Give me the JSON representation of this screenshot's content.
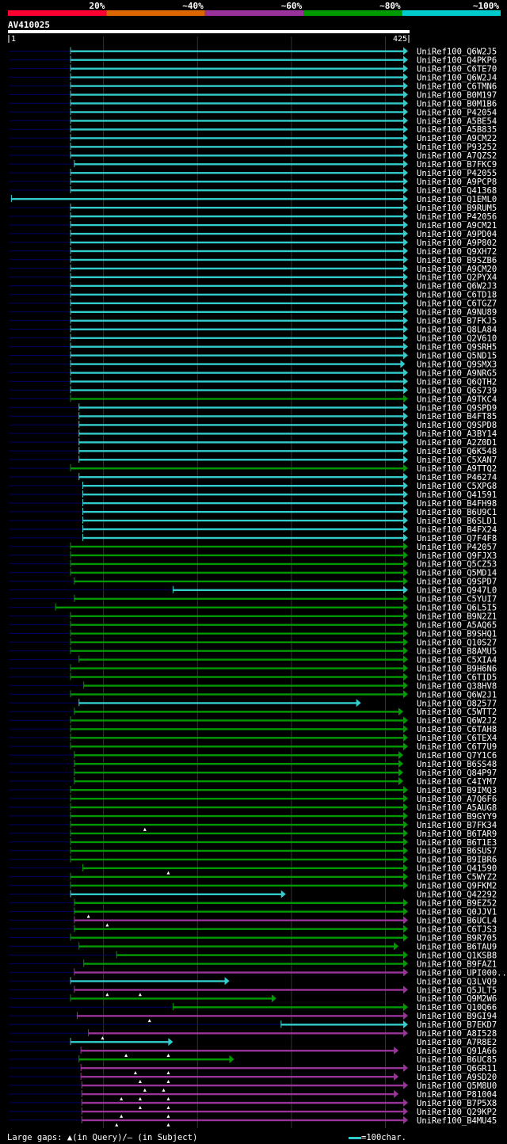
{
  "chart_data": {
    "type": "alignment-overview",
    "query_id": "AV410025",
    "query_start": "1",
    "query_end": "425",
    "query_length": 425,
    "identity_legend": [
      {
        "label": "20%",
        "color": "#ff0033"
      },
      {
        "label": "~40%",
        "color": "#dd6600"
      },
      {
        "label": "~60%",
        "color": "#993399"
      },
      {
        "label": "~80%",
        "color": "#009900"
      },
      {
        "label": "~100%",
        "color": "#00cccc"
      }
    ],
    "hits": [
      {
        "name": "UniRef100_Q6W2J5",
        "start": 66,
        "end": 425,
        "color": "cyan",
        "arrow": true
      },
      {
        "name": "UniRef100_Q4PKP6",
        "start": 66,
        "end": 425,
        "color": "cyan",
        "arrow": true
      },
      {
        "name": "UniRef100_C6TE70",
        "start": 66,
        "end": 425,
        "color": "cyan",
        "arrow": true
      },
      {
        "name": "UniRef100_Q6W2J4",
        "start": 66,
        "end": 425,
        "color": "cyan",
        "arrow": true
      },
      {
        "name": "UniRef100_C6TMN6",
        "start": 66,
        "end": 425,
        "color": "cyan",
        "arrow": true
      },
      {
        "name": "UniRef100_B0M197",
        "start": 66,
        "end": 425,
        "color": "cyan",
        "arrow": true
      },
      {
        "name": "UniRef100_B0M1B6",
        "start": 66,
        "end": 425,
        "color": "cyan",
        "arrow": true
      },
      {
        "name": "UniRef100_P42054",
        "start": 66,
        "end": 425,
        "color": "cyan",
        "arrow": true
      },
      {
        "name": "UniRef100_A5BE54",
        "start": 66,
        "end": 425,
        "color": "cyan",
        "arrow": true
      },
      {
        "name": "UniRef100_A5B835",
        "start": 66,
        "end": 425,
        "color": "cyan",
        "arrow": true
      },
      {
        "name": "UniRef100_A9CM22",
        "start": 66,
        "end": 425,
        "color": "cyan",
        "arrow": true
      },
      {
        "name": "UniRef100_P93252",
        "start": 66,
        "end": 425,
        "color": "cyan",
        "arrow": true
      },
      {
        "name": "UniRef100_A7QZS2",
        "start": 66,
        "end": 425,
        "color": "cyan",
        "arrow": true
      },
      {
        "name": "UniRef100_B7FKC9",
        "start": 70,
        "end": 425,
        "color": "cyan",
        "arrow": true
      },
      {
        "name": "UniRef100_P42055",
        "start": 66,
        "end": 425,
        "color": "cyan",
        "arrow": true
      },
      {
        "name": "UniRef100_A9PCP8",
        "start": 66,
        "end": 425,
        "color": "cyan",
        "arrow": true
      },
      {
        "name": "UniRef100_Q41368",
        "start": 66,
        "end": 425,
        "color": "cyan",
        "arrow": true
      },
      {
        "name": "UniRef100_Q1EML0",
        "start": 3,
        "end": 425,
        "color": "cyan",
        "arrow": true
      },
      {
        "name": "UniRef100_B9RUM5",
        "start": 66,
        "end": 425,
        "color": "cyan",
        "arrow": true
      },
      {
        "name": "UniRef100_P42056",
        "start": 66,
        "end": 425,
        "color": "cyan",
        "arrow": true
      },
      {
        "name": "UniRef100_A9CM21",
        "start": 66,
        "end": 425,
        "color": "cyan",
        "arrow": true
      },
      {
        "name": "UniRef100_A9PD04",
        "start": 66,
        "end": 425,
        "color": "cyan",
        "arrow": true
      },
      {
        "name": "UniRef100_A9P802",
        "start": 66,
        "end": 425,
        "color": "cyan",
        "arrow": true
      },
      {
        "name": "UniRef100_Q9XH72",
        "start": 66,
        "end": 425,
        "color": "cyan",
        "arrow": true
      },
      {
        "name": "UniRef100_B9SZB6",
        "start": 66,
        "end": 425,
        "color": "cyan",
        "arrow": true
      },
      {
        "name": "UniRef100_A9CM20",
        "start": 66,
        "end": 425,
        "color": "cyan",
        "arrow": true
      },
      {
        "name": "UniRef100_Q2PYX4",
        "start": 66,
        "end": 425,
        "color": "cyan",
        "arrow": true
      },
      {
        "name": "UniRef100_Q6W2J3",
        "start": 66,
        "end": 425,
        "color": "cyan",
        "arrow": true
      },
      {
        "name": "UniRef100_C6TD18",
        "start": 66,
        "end": 425,
        "color": "cyan",
        "arrow": true
      },
      {
        "name": "UniRef100_C6TGZ7",
        "start": 66,
        "end": 425,
        "color": "cyan",
        "arrow": true
      },
      {
        "name": "UniRef100_A9NU89",
        "start": 66,
        "end": 425,
        "color": "cyan",
        "arrow": true
      },
      {
        "name": "UniRef100_B7FKJ5",
        "start": 66,
        "end": 425,
        "color": "cyan",
        "arrow": true
      },
      {
        "name": "UniRef100_Q8LA84",
        "start": 66,
        "end": 425,
        "color": "cyan",
        "arrow": true
      },
      {
        "name": "UniRef100_Q2V610",
        "start": 66,
        "end": 425,
        "color": "cyan",
        "arrow": true
      },
      {
        "name": "UniRef100_Q9SRH5",
        "start": 66,
        "end": 425,
        "color": "cyan",
        "arrow": true
      },
      {
        "name": "UniRef100_Q5ND15",
        "start": 66,
        "end": 425,
        "color": "cyan",
        "arrow": true
      },
      {
        "name": "UniRef100_Q9SMX3",
        "start": 66,
        "end": 422,
        "color": "cyan",
        "arrow": true
      },
      {
        "name": "UniRef100_A9NRG5",
        "start": 66,
        "end": 425,
        "color": "cyan",
        "arrow": true
      },
      {
        "name": "UniRef100_Q6QTH2",
        "start": 66,
        "end": 425,
        "color": "cyan",
        "arrow": true
      },
      {
        "name": "UniRef100_Q6S739",
        "start": 66,
        "end": 425,
        "color": "cyan",
        "arrow": true
      },
      {
        "name": "UniRef100_A9TKC4",
        "start": 66,
        "end": 425,
        "color": "green",
        "arrow": true
      },
      {
        "name": "UniRef100_Q9SPD9",
        "start": 75,
        "end": 425,
        "color": "cyan",
        "arrow": true
      },
      {
        "name": "UniRef100_B4FT85",
        "start": 75,
        "end": 425,
        "color": "cyan",
        "arrow": true
      },
      {
        "name": "UniRef100_Q9SPD8",
        "start": 75,
        "end": 425,
        "color": "cyan",
        "arrow": true
      },
      {
        "name": "UniRef100_A3BY14",
        "start": 75,
        "end": 425,
        "color": "cyan",
        "arrow": true
      },
      {
        "name": "UniRef100_A2Z0D1",
        "start": 75,
        "end": 425,
        "color": "cyan",
        "arrow": true
      },
      {
        "name": "UniRef100_Q6K548",
        "start": 75,
        "end": 425,
        "color": "cyan",
        "arrow": true
      },
      {
        "name": "UniRef100_C5XAN7",
        "start": 75,
        "end": 425,
        "color": "cyan",
        "arrow": true
      },
      {
        "name": "UniRef100_A9TTQ2",
        "start": 66,
        "end": 425,
        "color": "green",
        "arrow": true
      },
      {
        "name": "UniRef100_P46274",
        "start": 75,
        "end": 425,
        "color": "cyan",
        "arrow": true
      },
      {
        "name": "UniRef100_C5XPG8",
        "start": 79,
        "end": 425,
        "color": "cyan",
        "arrow": true
      },
      {
        "name": "UniRef100_Q41591",
        "start": 79,
        "end": 425,
        "color": "cyan",
        "arrow": true
      },
      {
        "name": "UniRef100_B4FH98",
        "start": 79,
        "end": 425,
        "color": "cyan",
        "arrow": true
      },
      {
        "name": "UniRef100_B6U9C1",
        "start": 79,
        "end": 425,
        "color": "cyan",
        "arrow": true
      },
      {
        "name": "UniRef100_B6SLD1",
        "start": 79,
        "end": 425,
        "color": "cyan",
        "arrow": true
      },
      {
        "name": "UniRef100_B4FX24",
        "start": 79,
        "end": 425,
        "color": "cyan",
        "arrow": true
      },
      {
        "name": "UniRef100_Q7F4F8",
        "start": 79,
        "end": 425,
        "color": "cyan",
        "arrow": true
      },
      {
        "name": "UniRef100_P42057",
        "start": 66,
        "end": 425,
        "color": "green",
        "arrow": true
      },
      {
        "name": "UniRef100_Q9FJX3",
        "start": 66,
        "end": 425,
        "color": "green",
        "arrow": true
      },
      {
        "name": "UniRef100_Q5CZ53",
        "start": 66,
        "end": 425,
        "color": "green",
        "arrow": true
      },
      {
        "name": "UniRef100_Q5MD14",
        "start": 66,
        "end": 425,
        "color": "green",
        "arrow": true
      },
      {
        "name": "UniRef100_Q9SPD7",
        "start": 70,
        "end": 425,
        "color": "green",
        "arrow": true
      },
      {
        "name": "UniRef100_Q947L0",
        "start": 175,
        "end": 425,
        "color": "cyan",
        "arrow": true
      },
      {
        "name": "UniRef100_C5YUI7",
        "start": 70,
        "end": 425,
        "color": "green",
        "arrow": true
      },
      {
        "name": "UniRef100_Q6L5I5",
        "start": 50,
        "end": 425,
        "color": "green",
        "arrow": true
      },
      {
        "name": "UniRef100_B9N2Z1",
        "start": 66,
        "end": 425,
        "color": "green",
        "arrow": true
      },
      {
        "name": "UniRef100_A5AQ65",
        "start": 66,
        "end": 425,
        "color": "green",
        "arrow": true
      },
      {
        "name": "UniRef100_B9SHQ1",
        "start": 66,
        "end": 425,
        "color": "green",
        "arrow": true
      },
      {
        "name": "UniRef100_Q10S27",
        "start": 66,
        "end": 425,
        "color": "green",
        "arrow": true
      },
      {
        "name": "UniRef100_B8AMU5",
        "start": 66,
        "end": 425,
        "color": "green",
        "arrow": true
      },
      {
        "name": "UniRef100_C5XIA4",
        "start": 75,
        "end": 425,
        "color": "green",
        "arrow": true
      },
      {
        "name": "UniRef100_B9H6N6",
        "start": 66,
        "end": 425,
        "color": "green",
        "arrow": true
      },
      {
        "name": "UniRef100_C6TID5",
        "start": 66,
        "end": 425,
        "color": "green",
        "arrow": true
      },
      {
        "name": "UniRef100_Q38HV8",
        "start": 80,
        "end": 425,
        "color": "green",
        "arrow": true
      },
      {
        "name": "UniRef100_Q6W2J1",
        "start": 66,
        "end": 425,
        "color": "green",
        "arrow": true
      },
      {
        "name": "UniRef100_O82577",
        "start": 75,
        "end": 375,
        "color": "cyan",
        "arrow": true
      },
      {
        "name": "UniRef100_C5WTT2",
        "start": 70,
        "end": 420,
        "color": "green",
        "arrow": true
      },
      {
        "name": "UniRef100_Q6W2J2",
        "start": 66,
        "end": 425,
        "color": "green",
        "arrow": true
      },
      {
        "name": "UniRef100_C6TAH8",
        "start": 66,
        "end": 425,
        "color": "green",
        "arrow": true
      },
      {
        "name": "UniRef100_C6TEX4",
        "start": 66,
        "end": 425,
        "color": "green",
        "arrow": true
      },
      {
        "name": "UniRef100_C6T7U9",
        "start": 66,
        "end": 425,
        "color": "green",
        "arrow": true
      },
      {
        "name": "UniRef100_Q7Y1C6",
        "start": 70,
        "end": 420,
        "color": "green",
        "arrow": true
      },
      {
        "name": "UniRef100_B6SS48",
        "start": 70,
        "end": 420,
        "color": "green",
        "arrow": true
      },
      {
        "name": "UniRef100_Q84P97",
        "start": 70,
        "end": 420,
        "color": "green",
        "arrow": true
      },
      {
        "name": "UniRef100_C4IYM7",
        "start": 70,
        "end": 420,
        "color": "green",
        "arrow": true
      },
      {
        "name": "UniRef100_B9IMQ3",
        "start": 66,
        "end": 425,
        "color": "green",
        "arrow": true
      },
      {
        "name": "UniRef100_A7Q6F6",
        "start": 66,
        "end": 425,
        "color": "green",
        "arrow": true
      },
      {
        "name": "UniRef100_A5AUG8",
        "start": 66,
        "end": 425,
        "color": "green",
        "arrow": true
      },
      {
        "name": "UniRef100_B9GYY9",
        "start": 66,
        "end": 425,
        "color": "green",
        "arrow": true
      },
      {
        "name": "UniRef100_B7FK34",
        "start": 66,
        "end": 425,
        "color": "green",
        "arrow": true,
        "gaps_query": [
          145
        ]
      },
      {
        "name": "UniRef100_B6TAR9",
        "start": 66,
        "end": 425,
        "color": "green",
        "arrow": true
      },
      {
        "name": "UniRef100_B6T1E3",
        "start": 66,
        "end": 425,
        "color": "green",
        "arrow": true
      },
      {
        "name": "UniRef100_B6SUS7",
        "start": 66,
        "end": 425,
        "color": "green",
        "arrow": true
      },
      {
        "name": "UniRef100_B9IBR6",
        "start": 66,
        "end": 425,
        "color": "green",
        "arrow": true
      },
      {
        "name": "UniRef100_Q41590",
        "start": 79,
        "end": 425,
        "color": "green",
        "arrow": true,
        "gaps_query": [
          170
        ]
      },
      {
        "name": "UniRef100_C5WYZ2",
        "start": 66,
        "end": 425,
        "color": "green",
        "arrow": true
      },
      {
        "name": "UniRef100_Q9FKM2",
        "start": 66,
        "end": 425,
        "color": "green",
        "arrow": true
      },
      {
        "name": "UniRef100_Q42292",
        "start": 66,
        "end": 295,
        "color": "cyan",
        "arrow": true
      },
      {
        "name": "UniRef100_B9EZ52",
        "start": 70,
        "end": 425,
        "color": "green",
        "arrow": true
      },
      {
        "name": "UniRef100_Q0JJV1",
        "start": 70,
        "end": 425,
        "color": "green",
        "arrow": true,
        "gaps_query": [
          85
        ]
      },
      {
        "name": "UniRef100_B6UCL4",
        "start": 70,
        "end": 425,
        "color": "magenta",
        "arrow": true,
        "gaps_query": [
          105
        ]
      },
      {
        "name": "UniRef100_C6TJS3",
        "start": 70,
        "end": 425,
        "color": "green",
        "arrow": true
      },
      {
        "name": "UniRef100_B9R705",
        "start": 66,
        "end": 425,
        "color": "green",
        "arrow": true
      },
      {
        "name": "UniRef100_B6TAU9",
        "start": 75,
        "end": 415,
        "color": "green",
        "arrow": true
      },
      {
        "name": "UniRef100_Q1KSB8",
        "start": 115,
        "end": 425,
        "color": "green",
        "arrow": true
      },
      {
        "name": "UniRef100_B9FAZ1",
        "start": 80,
        "end": 425,
        "color": "green",
        "arrow": true
      },
      {
        "name": "UniRef100_UPI000...",
        "start": 70,
        "end": 425,
        "color": "magenta",
        "arrow": true
      },
      {
        "name": "UniRef100_Q3LVQ9",
        "start": 66,
        "end": 235,
        "color": "cyan",
        "arrow": true
      },
      {
        "name": "UniRef100_Q5JLT5",
        "start": 70,
        "end": 425,
        "color": "magenta",
        "arrow": true,
        "gaps_query": [
          105,
          140
        ]
      },
      {
        "name": "UniRef100_Q9M2W6",
        "start": 66,
        "end": 285,
        "color": "green",
        "arrow": true
      },
      {
        "name": "UniRef100_Q10Q66",
        "start": 175,
        "end": 425,
        "color": "green",
        "arrow": true
      },
      {
        "name": "UniRef100_B9GI94",
        "start": 73,
        "end": 425,
        "color": "magenta",
        "arrow": true,
        "gaps_query": [
          150
        ]
      },
      {
        "name": "UniRef100_B7EKD7",
        "start": 290,
        "end": 425,
        "color": "cyan",
        "arrow": true
      },
      {
        "name": "UniRef100_A8I528",
        "start": 85,
        "end": 425,
        "color": "magenta",
        "arrow": true,
        "gaps_query": [
          100
        ]
      },
      {
        "name": "UniRef100_A7R8E2",
        "start": 66,
        "end": 175,
        "color": "cyan",
        "arrow": true
      },
      {
        "name": "UniRef100_Q91A66",
        "start": 77,
        "end": 415,
        "color": "magenta",
        "arrow": true,
        "gaps_query": [
          125,
          170
        ]
      },
      {
        "name": "UniRef100_B6UC85",
        "start": 75,
        "end": 240,
        "color": "green",
        "arrow": true
      },
      {
        "name": "UniRef100_Q6GR11",
        "start": 77,
        "end": 425,
        "color": "magenta",
        "arrow": true,
        "gaps_query": [
          135,
          170
        ]
      },
      {
        "name": "UniRef100_A9SD20",
        "start": 77,
        "end": 415,
        "color": "magenta",
        "arrow": true,
        "gaps_query": [
          140,
          170
        ]
      },
      {
        "name": "UniRef100_Q5M8U0",
        "start": 78,
        "end": 425,
        "color": "magenta",
        "arrow": true,
        "gaps_query": [
          145,
          165
        ]
      },
      {
        "name": "UniRef100_P81004",
        "start": 78,
        "end": 415,
        "color": "magenta",
        "arrow": true,
        "gaps_query": [
          120,
          140,
          170
        ]
      },
      {
        "name": "UniRef100_B7P5X8",
        "start": 78,
        "end": 425,
        "color": "magenta",
        "arrow": true,
        "gaps_query": [
          140,
          170
        ]
      },
      {
        "name": "UniRef100_Q29KP2",
        "start": 78,
        "end": 425,
        "color": "magenta",
        "arrow": true,
        "gaps_query": [
          120,
          170
        ]
      },
      {
        "name": "UniRef100_B4MU45",
        "start": 78,
        "end": 425,
        "color": "magenta",
        "arrow": true,
        "gaps_query": [
          115,
          170
        ]
      }
    ]
  },
  "footer": {
    "gaps_prefix": "Large gaps:",
    "gaps_query_label": "(in Query)/",
    "gaps_subject_label": "(in Subject)",
    "scale_label": "=100char."
  },
  "colors": {
    "background": "#000000",
    "cyan": "#33cccc",
    "green": "#009900",
    "magenta": "#993399",
    "query_bar": "#ffffff",
    "unaligned": "#000066"
  }
}
